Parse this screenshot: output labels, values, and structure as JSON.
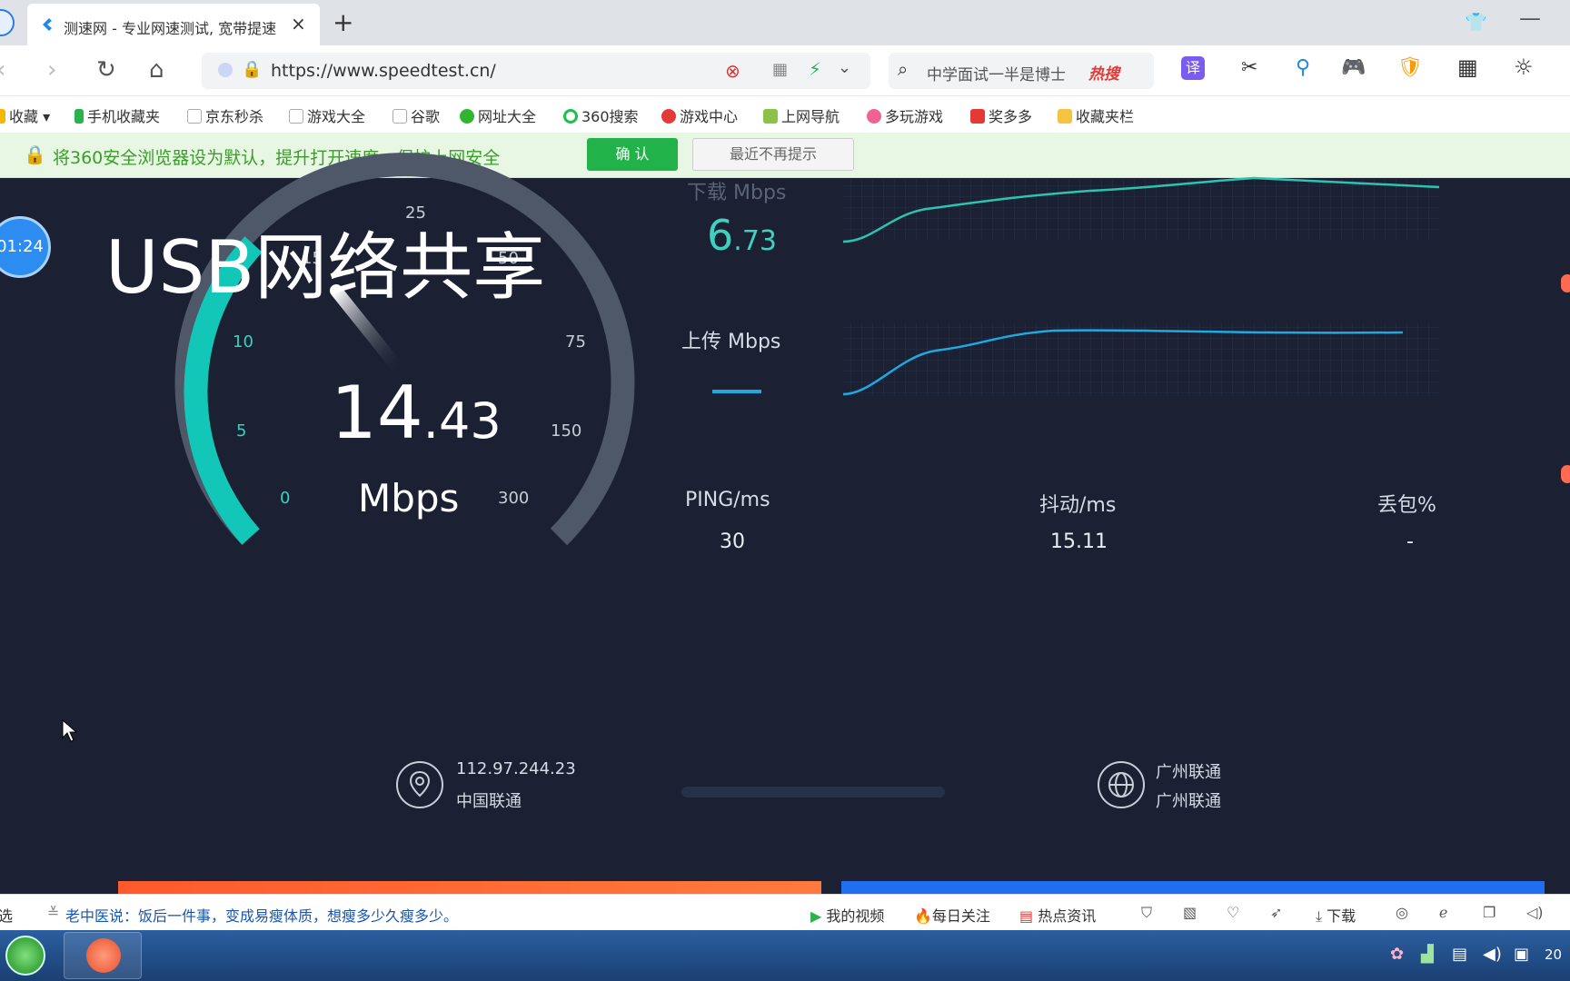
{
  "browser": {
    "tab_title": "测速网 - 专业网速测试, 宽带提速",
    "tab_close": "×",
    "new_tab": "+",
    "url": "https://www.speedtest.cn/",
    "search_text": "中学面试一半是博士",
    "hot_label": "热搜",
    "tool_translate": "译"
  },
  "bookmarks": [
    "收藏",
    "手机收藏夹",
    "京东秒杀",
    "游戏大全",
    "谷歌",
    "网址大全",
    "360搜索",
    "游戏中心",
    "上网导航",
    "多玩游戏",
    "奖多多",
    "收藏夹栏"
  ],
  "infobar": {
    "text": "将360安全浏览器设为默认，提升打开速度，保护上网安全",
    "confirm": "确 认",
    "dismiss": "最近不再提示"
  },
  "overlay": {
    "title": "USB网络共享",
    "timer": "01:24"
  },
  "gauge": {
    "ticks": [
      "0",
      "5",
      "10",
      "15",
      "25",
      "50",
      "75",
      "150",
      "300"
    ],
    "value_int": "14",
    "value_dec": ".43",
    "unit": "Mbps",
    "accent": "#12c6b8",
    "track": "#4e5869"
  },
  "download": {
    "label": "下载 Mbps",
    "value_int": "6",
    "value_dec": ".73",
    "color": "#3fd0c0"
  },
  "upload": {
    "label": "上传 Mbps",
    "color": "#1fa9e0"
  },
  "stats": {
    "ping_label": "PING/ms",
    "ping_value": "30",
    "jitter_label": "抖动/ms",
    "jitter_value": "15.11",
    "loss_label": "丢包%",
    "loss_value": "-"
  },
  "client": {
    "ip": "112.97.244.23",
    "isp": "中国联通"
  },
  "server": {
    "city_isp": "广州联通",
    "isp": "广州联通"
  },
  "statusbar": {
    "ticker_prefix": "选",
    "ticker": "老中医说：饭后一件事，变成易瘦体质，想瘦多少久瘦多少。",
    "my_video": "我的视频",
    "daily": "每日关注",
    "hot_news": "热点资讯",
    "download": "下载"
  },
  "taskbar": {
    "clock": "20"
  }
}
